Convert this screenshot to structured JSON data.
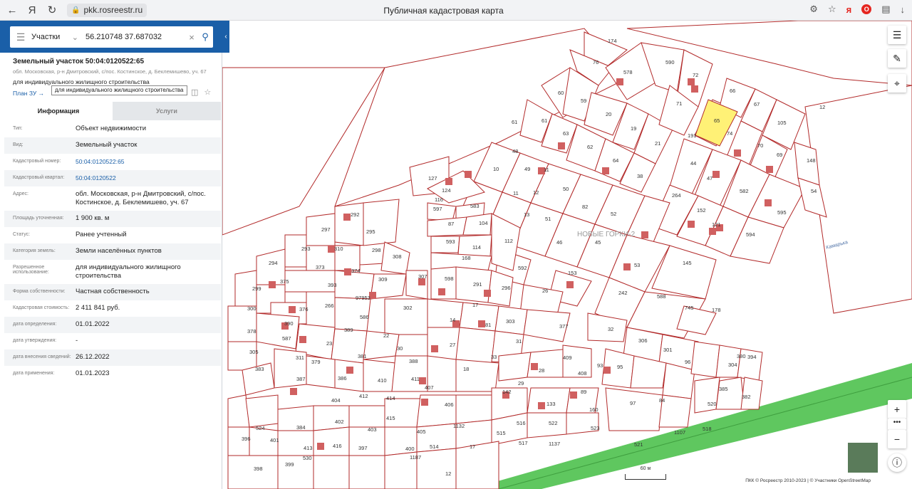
{
  "browser": {
    "url": "pkk.rosreestr.ru",
    "title": "Публичная кадастровая карта"
  },
  "search": {
    "type": "Участки",
    "coords": "56.210748 37.687032"
  },
  "object": {
    "title": "Земельный участок 50:04:0120522:65",
    "address": "обл. Московская, р-н Дмитровский, с/пос. Костинское, д. Беклемишево, уч. 67",
    "use": "для индивидуального жилищного строительства",
    "plan_link": "План ЗУ →",
    "tooltip": "для индивидуального жилищного строительства"
  },
  "tabs": [
    "Информация",
    "Услуги"
  ],
  "info": [
    {
      "key": "Тип:",
      "value": "Объект недвижимости",
      "link": false
    },
    {
      "key": "Вид:",
      "value": "Земельный участок",
      "link": false
    },
    {
      "key": "Кадастровый номер:",
      "value": "50:04:0120522:65",
      "link": true
    },
    {
      "key": "Кадастровый квартал:",
      "value": "50:04:0120522",
      "link": true
    },
    {
      "key": "Адрес:",
      "value": "обл. Московская, р-н Дмитровский, с/пос. Костинское, д. Беклемишево, уч. 67",
      "link": false
    },
    {
      "key": "Площадь уточненная:",
      "value": "1 900 кв. м",
      "link": false
    },
    {
      "key": "Статус:",
      "value": "Ранее учтенный",
      "link": false
    },
    {
      "key": "Категория земель:",
      "value": "Земли населённых пунктов",
      "link": false
    },
    {
      "key": "Разрешенное использование:",
      "value": "для индивидуального жилищного строительства",
      "link": false
    },
    {
      "key": "Форма собственности:",
      "value": "Частная собственность",
      "link": false
    },
    {
      "key": "Кадастровая стоимость:",
      "value": "2 411 841 руб.",
      "link": false
    },
    {
      "key": "дата определения:",
      "value": "01.01.2022",
      "link": false
    },
    {
      "key": "дата утверждения:",
      "value": "-",
      "link": false
    },
    {
      "key": "дата внесения сведений:",
      "value": "26.12.2022",
      "link": false
    },
    {
      "key": "дата применения:",
      "value": "01.01.2023",
      "link": false
    }
  ],
  "map": {
    "place_label": "НОВЫЕ ГОРКИ-2",
    "river_label": "Камарька",
    "scale": "60 м",
    "attribution": "ПКК © Росреестр 2010-2023 | © Участники OpenStreetMap",
    "highlight_color": "#fff176",
    "parcel_color": "#b22a2a",
    "road_color": "#5fc75f",
    "parcel_labels": [
      "174",
      "76",
      "578",
      "590",
      "72",
      "60",
      "59",
      "20",
      "19",
      "21",
      "61",
      "61",
      "63",
      "62",
      "64",
      "38",
      "71",
      "66",
      "67",
      "65",
      "74",
      "70",
      "105",
      "69",
      "191",
      "12",
      "48",
      "49",
      "10",
      "11",
      "11",
      "12",
      "50",
      "82",
      "52",
      "13",
      "51",
      "46",
      "45",
      "44",
      "47",
      "582",
      "264",
      "152",
      "121",
      "595",
      "594",
      "148",
      "54",
      "153",
      "53",
      "145",
      "242",
      "588",
      "745",
      "178",
      "127",
      "124",
      "116",
      "597",
      "583",
      "87",
      "104",
      "593",
      "114",
      "112",
      "592",
      "26",
      "168",
      "598",
      "291",
      "296",
      "292",
      "297",
      "295",
      "293",
      "310",
      "298",
      "294",
      "373",
      "374",
      "308",
      "309",
      "299",
      "375",
      "393",
      "97953",
      "307",
      "302",
      "300",
      "376",
      "266",
      "586",
      "17",
      "14",
      "81",
      "303",
      "377",
      "390",
      "389",
      "22",
      "30",
      "31",
      "32",
      "306",
      "301",
      "378",
      "587",
      "23",
      "27",
      "33",
      "93",
      "305",
      "311",
      "379",
      "381",
      "388",
      "18",
      "409",
      "408",
      "95",
      "96",
      "304",
      "394",
      "380",
      "383",
      "387",
      "386",
      "410",
      "411",
      "407",
      "28",
      "29",
      "89",
      "97",
      "84",
      "520",
      "382",
      "385",
      "404",
      "412",
      "414",
      "406",
      "142",
      "133",
      "160",
      "1107",
      "518",
      "521",
      "524",
      "384",
      "402",
      "403",
      "415",
      "405",
      "1132",
      "515",
      "516",
      "522",
      "523",
      "396",
      "401",
      "413",
      "416",
      "397",
      "400",
      "514",
      "517",
      "1137",
      "398",
      "399",
      "530",
      "1187",
      "17",
      "12"
    ]
  }
}
